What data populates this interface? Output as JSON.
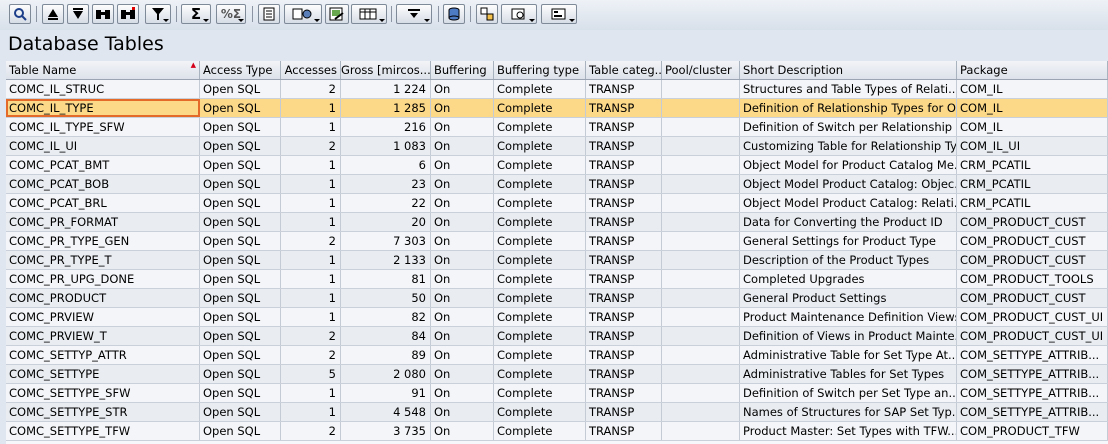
{
  "page": {
    "title": "Database Tables"
  },
  "toolbar": {
    "buttons": [
      {
        "icon": "detail-icon"
      },
      {
        "icon": "sort-ascending-icon"
      },
      {
        "icon": "filter-funnel-icon"
      },
      {
        "icon": "find-icon"
      },
      {
        "icon": "set-filter-icon"
      },
      {
        "icon": "sum-icon"
      },
      {
        "icon": "subtotal-icon"
      },
      {
        "icon": "print-preview-icon"
      },
      {
        "icon": "export-icon"
      },
      {
        "icon": "local-file-icon"
      },
      {
        "icon": "change-layout-icon"
      },
      {
        "icon": "select-layout-icon"
      },
      {
        "icon": "save-layout-icon"
      },
      {
        "icon": "graphic-icon"
      },
      {
        "icon": "information-icon"
      },
      {
        "icon": "view-icon"
      }
    ]
  },
  "table": {
    "columns": [
      "Table Name",
      "Access Type",
      "Accesses",
      "Gross [mircos...",
      "Buffering",
      "Buffering type",
      "Table categ...",
      "Pool/cluster",
      "Short Description",
      "Package"
    ],
    "rows": [
      [
        "COMC_IL_STRUC",
        "Open SQL",
        "2",
        "1 224",
        "On",
        "Complete",
        "TRANSP",
        "",
        "Structures and Table Types of Relati...",
        "COM_IL"
      ],
      [
        "COMC_IL_TYPE",
        "Open SQL",
        "1",
        "1 285",
        "On",
        "Complete",
        "TRANSP",
        "",
        "Definition of Relationship Types for O...",
        "COM_IL"
      ],
      [
        "COMC_IL_TYPE_SFW",
        "Open SQL",
        "1",
        "216",
        "On",
        "Complete",
        "TRANSP",
        "",
        "Definition of Switch per Relationship ...",
        "COM_IL"
      ],
      [
        "COMC_IL_UI",
        "Open SQL",
        "2",
        "1 083",
        "On",
        "Complete",
        "TRANSP",
        "",
        "Customizing Table for Relationship Ty...",
        "COM_IL_UI"
      ],
      [
        "COMC_PCAT_BMT",
        "Open SQL",
        "1",
        "6",
        "On",
        "Complete",
        "TRANSP",
        "",
        "Object Model for Product Catalog Me...",
        "CRM_PCATIL"
      ],
      [
        "COMC_PCAT_BOB",
        "Open SQL",
        "1",
        "23",
        "On",
        "Complete",
        "TRANSP",
        "",
        "Object Model Product Catalog: Objec...",
        "CRM_PCATIL"
      ],
      [
        "COMC_PCAT_BRL",
        "Open SQL",
        "1",
        "22",
        "On",
        "Complete",
        "TRANSP",
        "",
        "Object Model Product Catalog: Relati...",
        "CRM_PCATIL"
      ],
      [
        "COMC_PR_FORMAT",
        "Open SQL",
        "1",
        "20",
        "On",
        "Complete",
        "TRANSP",
        "",
        "Data for Converting the Product ID",
        "COM_PRODUCT_CUST"
      ],
      [
        "COMC_PR_TYPE_GEN",
        "Open SQL",
        "2",
        "7 303",
        "On",
        "Complete",
        "TRANSP",
        "",
        "General Settings for Product Type",
        "COM_PRODUCT_CUST"
      ],
      [
        "COMC_PR_TYPE_T",
        "Open SQL",
        "1",
        "2 133",
        "On",
        "Complete",
        "TRANSP",
        "",
        "Description of the Product Types",
        "COM_PRODUCT_CUST"
      ],
      [
        "COMC_PR_UPG_DONE",
        "Open SQL",
        "1",
        "81",
        "On",
        "Complete",
        "TRANSP",
        "",
        "Completed Upgrades",
        "COM_PRODUCT_TOOLS"
      ],
      [
        "COMC_PRODUCT",
        "Open SQL",
        "1",
        "50",
        "On",
        "Complete",
        "TRANSP",
        "",
        "General Product Settings",
        "COM_PRODUCT_CUST"
      ],
      [
        "COMC_PRVIEW",
        "Open SQL",
        "1",
        "82",
        "On",
        "Complete",
        "TRANSP",
        "",
        "Product Maintenance Definition Views",
        "COM_PRODUCT_CUST_UI"
      ],
      [
        "COMC_PRVIEW_T",
        "Open SQL",
        "2",
        "84",
        "On",
        "Complete",
        "TRANSP",
        "",
        "Definition of Views in Product Mainte...",
        "COM_PRODUCT_CUST_UI"
      ],
      [
        "COMC_SETTYP_ATTR",
        "Open SQL",
        "2",
        "89",
        "On",
        "Complete",
        "TRANSP",
        "",
        "Administrative Table for Set Type At...",
        "COM_SETTYPE_ATTRIB..."
      ],
      [
        "COMC_SETTYPE",
        "Open SQL",
        "5",
        "2 080",
        "On",
        "Complete",
        "TRANSP",
        "",
        "Administrative Tables for Set Types",
        "COM_SETTYPE_ATTRIB..."
      ],
      [
        "COMC_SETTYPE_SFW",
        "Open SQL",
        "1",
        "91",
        "On",
        "Complete",
        "TRANSP",
        "",
        "Definition of Switch per Set Type an...",
        "COM_SETTYPE_ATTRIB..."
      ],
      [
        "COMC_SETTYPE_STR",
        "Open SQL",
        "1",
        "4 548",
        "On",
        "Complete",
        "TRANSP",
        "",
        "Names of Structures for SAP Set Typ...",
        "COM_SETTYPE_ATTRIB..."
      ],
      [
        "COMC_SETTYPE_TFW",
        "Open SQL",
        "2",
        "3 735",
        "On",
        "Complete",
        "TRANSP",
        "",
        "Product Master: Set Types with TFW...",
        "COM_PRODUCT_TFW"
      ]
    ],
    "selected_row": 1
  }
}
